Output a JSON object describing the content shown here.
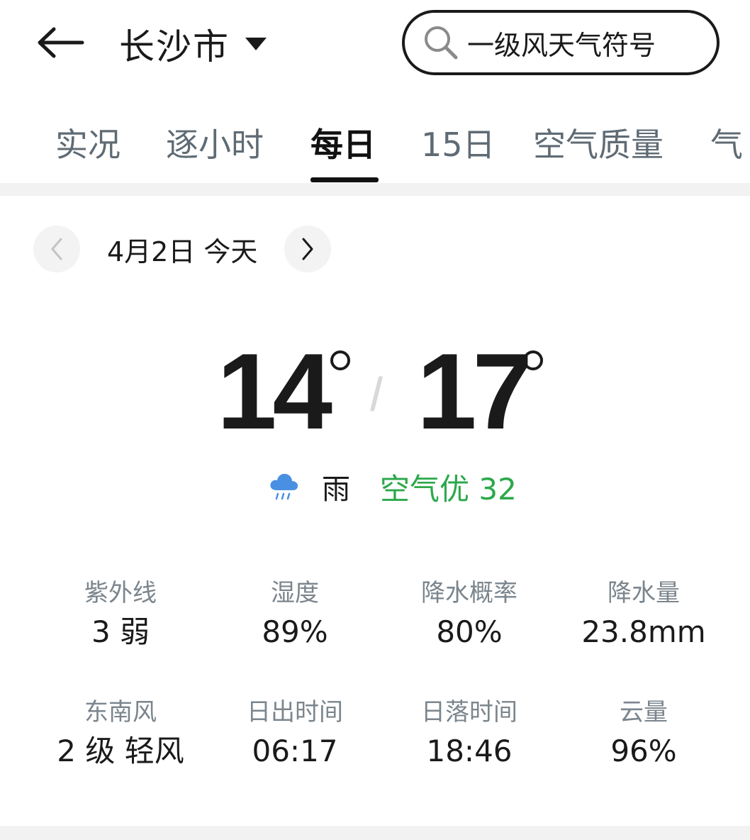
{
  "header": {
    "back_icon": "arrow-left-icon",
    "city": "长沙市",
    "search_placeholder": "一级风天气符号"
  },
  "tabs": [
    {
      "label": "实况",
      "active": false
    },
    {
      "label": "逐小时",
      "active": false
    },
    {
      "label": "每日",
      "active": true
    },
    {
      "label": "15日",
      "active": false
    },
    {
      "label": "空气质量",
      "active": false
    },
    {
      "label": "气",
      "active": false
    }
  ],
  "date_nav": {
    "label": "4月2日 今天",
    "prev_icon": "chevron-left-icon",
    "next_icon": "chevron-right-icon"
  },
  "weather": {
    "temp_low": "14",
    "temp_high": "17",
    "condition": "雨",
    "condition_icon": "rain-cloud-icon",
    "aqi": "空气优 32",
    "aqi_color": "#2ba84a"
  },
  "stats": [
    {
      "label": "紫外线",
      "value": "3 弱"
    },
    {
      "label": "湿度",
      "value": "89%"
    },
    {
      "label": "降水概率",
      "value": "80%"
    },
    {
      "label": "降水量",
      "value": "23.8mm"
    },
    {
      "label": "东南风",
      "value": "2 级 轻风"
    },
    {
      "label": "日出时间",
      "value": "06:17"
    },
    {
      "label": "日落时间",
      "value": "18:46"
    },
    {
      "label": "云量",
      "value": "96%"
    }
  ]
}
